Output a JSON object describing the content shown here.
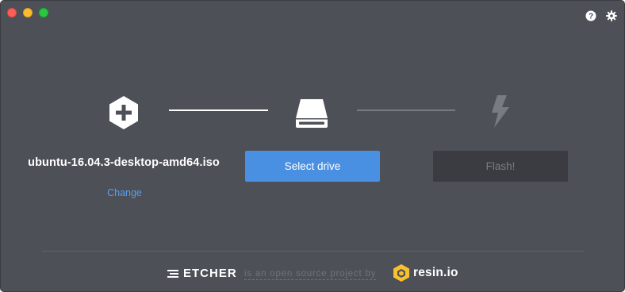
{
  "window": {
    "traffic_lights": [
      "close",
      "minimize",
      "maximize"
    ]
  },
  "header": {
    "icons": [
      "help-icon",
      "settings-gear-icon"
    ]
  },
  "steps": {
    "image": {
      "icon": "plus-hexagon-icon",
      "filename": "ubuntu-16.04.3-desktop-amd64.iso",
      "change_label": "Change"
    },
    "drive": {
      "icon": "hard-drive-icon",
      "button_label": "Select drive"
    },
    "flash": {
      "icon": "lightning-bolt-icon",
      "button_label": "Flash!"
    }
  },
  "footer": {
    "etcher_wordmark": "ETCHER",
    "tagline": "is an open source project by",
    "resin_wordmark": "resin.io"
  },
  "colors": {
    "background": "#4d5057",
    "accent_blue": "#4a90e2",
    "link_blue": "#5a9dec",
    "disabled_button": "#3a3c41",
    "disabled_text": "#7a7c82"
  }
}
